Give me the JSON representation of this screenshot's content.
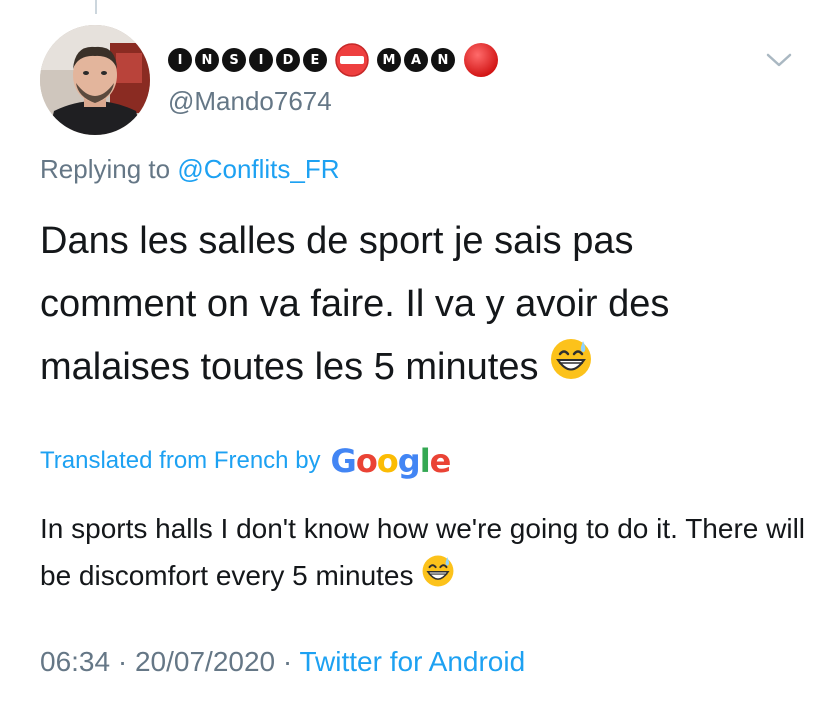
{
  "tweet": {
    "display_name_parts": [
      "I",
      "N",
      "S",
      "I",
      "D",
      "E",
      "M",
      "A",
      "N"
    ],
    "display_name_emoji": [
      "no-entry-icon",
      "red-circle-icon"
    ],
    "handle": "@Mando7674",
    "replying_prefix": "Replying to ",
    "replying_to": "@Conflits_FR",
    "text": "Dans les salles de sport je sais pas comment on va faire. Il va y avoir des malaises toutes les 5 minutes",
    "translated_label": "Translated from French by",
    "translator": "Google",
    "translation": "In sports halls I don't know how we're going to do it. There will be discomfort every 5 minutes",
    "time": "06:34",
    "date": "20/07/2020",
    "source": "Twitter for Android",
    "separator": "·"
  },
  "colors": {
    "link": "#1da1f2",
    "secondary": "#657786",
    "text": "#14171a",
    "google_blue": "#4285f4",
    "google_red": "#ea4335",
    "google_yellow": "#fbbc05",
    "google_green": "#34a853"
  }
}
